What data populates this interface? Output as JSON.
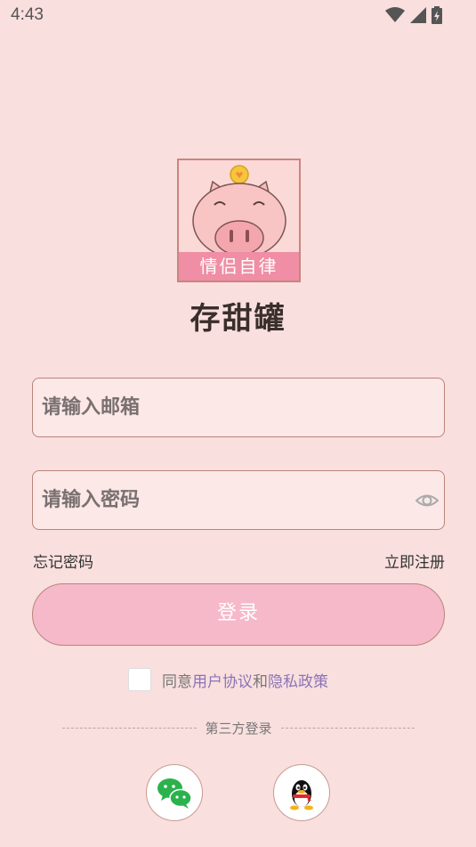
{
  "status": {
    "time": "4:43"
  },
  "logo": {
    "banner_text": "情侣自律"
  },
  "app": {
    "name": "存甜罐"
  },
  "form": {
    "email_placeholder": "请输入邮箱",
    "password_placeholder": "请输入密码",
    "forgot_label": "忘记密码",
    "register_label": "立即注册",
    "login_label": "登录"
  },
  "agreement": {
    "prefix": "同意",
    "user_agreement": "用户协议",
    "and": "和",
    "privacy_policy": "隐私政策"
  },
  "third_party": {
    "title": "第三方登录",
    "options": [
      {
        "icon": "wechat-icon"
      },
      {
        "icon": "qq-icon"
      }
    ]
  },
  "colors": {
    "background": "#f9dfdd",
    "button": "#f6b9c9",
    "link": "#8a74b8",
    "border": "#b9857b"
  }
}
